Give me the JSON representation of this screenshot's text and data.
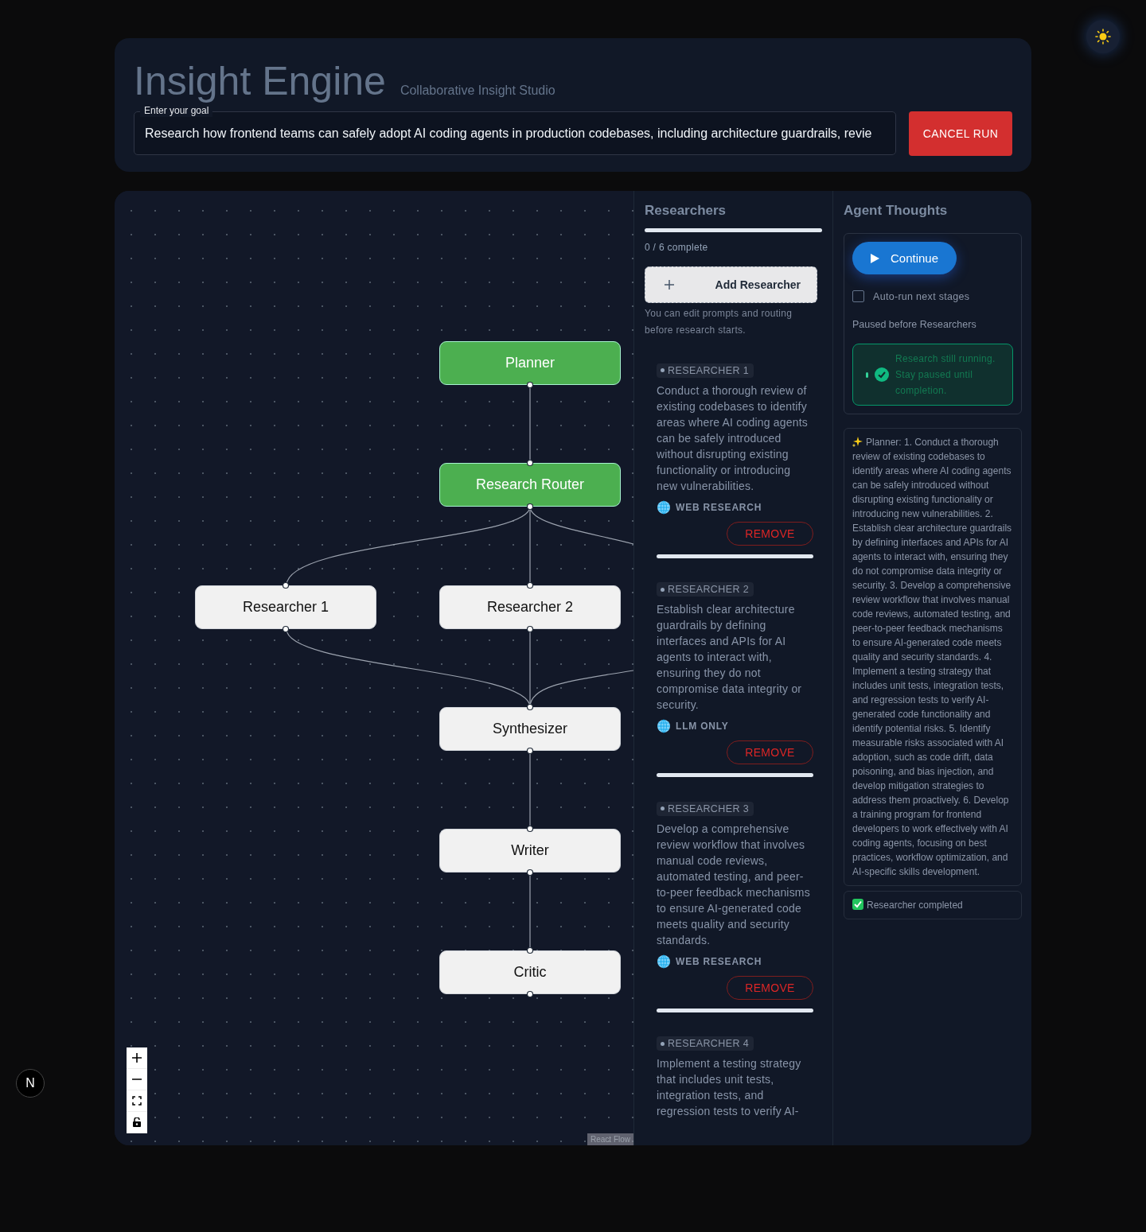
{
  "header": {
    "title": "Insight Engine",
    "subtitle": "Collaborative Insight Studio",
    "goal": {
      "label": "Enter your goal",
      "value": "Research how frontend teams can safely adopt AI coding agents in production codebases, including architecture guardrails, revie"
    },
    "cancel_button": "CANCEL RUN"
  },
  "flow": {
    "nodes": [
      {
        "label": "Planner",
        "completed": true
      },
      {
        "label": "Research Router",
        "completed": true
      },
      {
        "label": "Researcher 1",
        "completed": false
      },
      {
        "label": "Researcher 2",
        "completed": false
      },
      {
        "label": "Synthesizer",
        "completed": false
      },
      {
        "label": "Writer",
        "completed": false
      },
      {
        "label": "Critic",
        "completed": false
      }
    ],
    "attribution": "React Flow"
  },
  "researchers": {
    "title": "Researchers",
    "progress": {
      "level": 0,
      "label": "0 / 6 complete"
    },
    "add_button": "Add Researcher",
    "hint": "You can edit prompts and routing before research starts.",
    "items": [
      {
        "label": "RESEARCHER 1",
        "prompt": "Conduct a thorough review of existing codebases to identify areas where AI coding agents can be safely introduced without disrupting existing functionality or introducing new vulnerabilities.",
        "mode": "WEB RESEARCH",
        "remove": "REMOVE"
      },
      {
        "label": "RESEARCHER 2",
        "prompt": "Establish clear architecture guardrails by defining interfaces and APIs for AI agents to interact with, ensuring they do not compromise data integrity or security.",
        "mode": "LLM ONLY",
        "remove": "REMOVE"
      },
      {
        "label": "RESEARCHER 3",
        "prompt": "Develop a comprehensive review workflow that involves manual code reviews, automated testing, and peer-to-peer feedback mechanisms to ensure AI-generated code meets quality and security standards.",
        "mode": "WEB RESEARCH",
        "remove": "REMOVE"
      },
      {
        "label": "RESEARCHER 4",
        "prompt": "Implement a testing strategy that includes unit tests, integration tests, and regression tests to verify AI-"
      }
    ]
  },
  "thoughts": {
    "title": "Agent Thoughts",
    "continue_button": "Continue",
    "auto_run": {
      "label": "Auto-run next stages",
      "checked": false
    },
    "status": "Paused before Researchers",
    "notice": "Research still running. Stay paused until completion.",
    "log": [
      {
        "kind": "sparkle",
        "text": "Planner: 1. Conduct a thorough review of existing codebases to identify areas where AI coding agents can be safely introduced without disrupting existing functionality or introducing new vulnerabilities. 2. Establish clear architecture guardrails by defining interfaces and APIs for AI agents to interact with, ensuring they do not compromise data integrity or security. 3. Develop a comprehensive review workflow that involves manual code reviews, automated testing, and peer-to-peer feedback mechanisms to ensure AI-generated code meets quality and security standards. 4. Implement a testing strategy that includes unit tests, integration tests, and regression tests to verify AI-generated code functionality and identify potential risks. 5. Identify measurable risks associated with AI adoption, such as code drift, data poisoning, and bias injection, and develop mitigation strategies to address them proactively. 6. Develop a training program for frontend developers to work effectively with AI coding agents, focusing on best practices, workflow optimization, and AI-specific skills development."
      },
      {
        "kind": "check",
        "text": "Researcher completed"
      }
    ]
  },
  "dev_badge": "N"
}
